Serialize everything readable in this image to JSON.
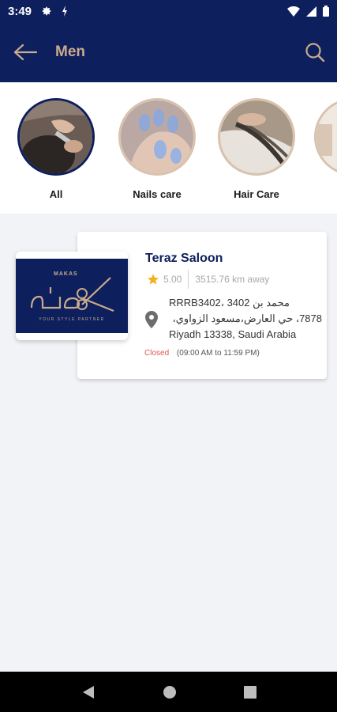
{
  "status_bar": {
    "time": "3:49"
  },
  "app_bar": {
    "title": "Men"
  },
  "categories": [
    {
      "label": "All",
      "selected": true
    },
    {
      "label": "Nails care",
      "selected": false
    },
    {
      "label": "Hair Care",
      "selected": false
    }
  ],
  "shop": {
    "name": "Teraz Saloon",
    "rating": "5.00",
    "distance": "3515.76 km away",
    "address_line1": "RRRB3402، 3402 محمد بن",
    "address_line2": "7878، حي العارض،مسعود الزواوي،",
    "address_line3": "Riyadh 13338, Saudi Arabia",
    "status": "Closed",
    "hours": "(09:00 AM to 11:59 PM)",
    "logo_text": "MAKAS",
    "logo_tagline": "YOUR STYLE PARTNER"
  },
  "colors": {
    "brand_navy": "#0d1f5c",
    "accent_gold": "#c8aa8d",
    "closed_red": "#e0584f",
    "star": "#f2b01e"
  }
}
